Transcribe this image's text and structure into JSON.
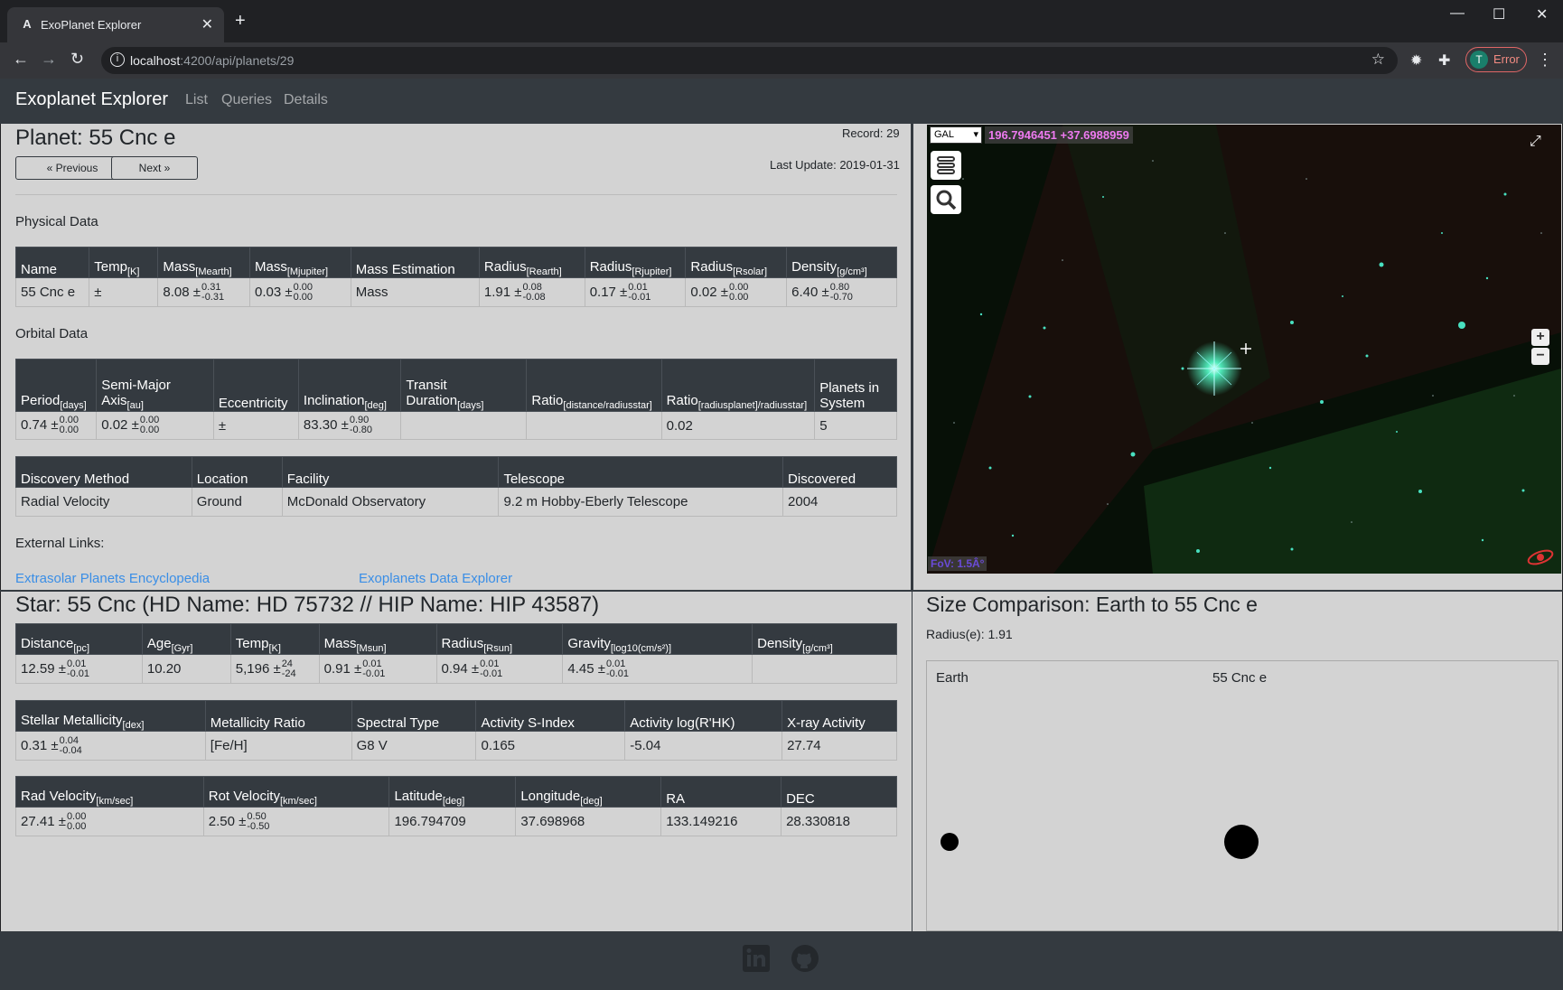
{
  "browser": {
    "tab_title": "ExoPlanet Explorer",
    "tab_close": "✕",
    "new_tab": "+",
    "url_host": "localhost",
    "url_path": ":4200/api/planets/29",
    "profile_initial": "T",
    "profile_status": "Error"
  },
  "app": {
    "brand": "Exoplanet Explorer",
    "nav": [
      "List",
      "Queries",
      "Details"
    ]
  },
  "planet": {
    "title": "Planet: 55 Cnc e",
    "record": "Record: 29",
    "last_update": "Last Update: 2019-01-31",
    "prev_label": "« Previous",
    "next_label": "Next »",
    "physical_label": "Physical Data",
    "orbital_label": "Orbital Data",
    "external_label": "External Links:",
    "links": [
      "Extrasolar Planets Encyclopedia",
      "Exoplanets Data Explorer"
    ],
    "physical": {
      "headers": [
        {
          "t": "Name",
          "s": ""
        },
        {
          "t": "Temp",
          "s": "[K]"
        },
        {
          "t": "Mass",
          "s": "[Mearth]"
        },
        {
          "t": "Mass",
          "s": "[Mjupiter]"
        },
        {
          "t": "Mass Estimation",
          "s": ""
        },
        {
          "t": "Radius",
          "s": "[Rearth]"
        },
        {
          "t": "Radius",
          "s": "[Rjupiter]"
        },
        {
          "t": "Radius",
          "s": "[Rsolar]"
        },
        {
          "t": "Density",
          "s": "[g/cm³]"
        }
      ],
      "row": [
        {
          "v": "55 Cnc e"
        },
        {
          "v": "±"
        },
        {
          "v": "8.08 ±",
          "up": "0.31",
          "dn": "-0.31"
        },
        {
          "v": "0.03 ±",
          "up": "0.00",
          "dn": "0.00"
        },
        {
          "v": "Mass"
        },
        {
          "v": "1.91 ±",
          "up": "0.08",
          "dn": "-0.08"
        },
        {
          "v": "0.17 ±",
          "up": "0.01",
          "dn": "-0.01"
        },
        {
          "v": "0.02 ±",
          "up": "0.00",
          "dn": "0.00"
        },
        {
          "v": "6.40 ±",
          "up": "0.80",
          "dn": "-0.70"
        }
      ]
    },
    "orbital": {
      "headers": [
        {
          "t": "Period",
          "s": "[days]"
        },
        {
          "t": "Semi-Major Axis",
          "s": "[au]"
        },
        {
          "t": "Eccentricity",
          "s": ""
        },
        {
          "t": "Inclination",
          "s": "[deg]"
        },
        {
          "t": "Transit Duration",
          "s": "[days]"
        },
        {
          "t": "Ratio",
          "s": "[distance/radiusstar]"
        },
        {
          "t": "Ratio",
          "s": "[radiusplanet]/radiusstar]"
        },
        {
          "t": "Planets in System",
          "s": ""
        }
      ],
      "row": [
        {
          "v": "0.74 ±",
          "up": "0.00",
          "dn": "0.00"
        },
        {
          "v": "0.02 ±",
          "up": "0.00",
          "dn": "0.00"
        },
        {
          "v": "±"
        },
        {
          "v": "83.30 ±",
          "up": "0.90",
          "dn": "-0.80"
        },
        {
          "v": ""
        },
        {
          "v": ""
        },
        {
          "v": "0.02"
        },
        {
          "v": "5"
        }
      ]
    },
    "discovery": {
      "headers": [
        "Discovery Method",
        "Location",
        "Facility",
        "Telescope",
        "Discovered"
      ],
      "row": [
        "Radial Velocity",
        "Ground",
        "McDonald Observatory",
        "9.2 m Hobby-Eberly Telescope",
        "2004"
      ]
    }
  },
  "sky": {
    "frame": "GAL",
    "coords": "196.7946451 +37.6988959",
    "fov": "FoV: 1.5Â°",
    "zoom_in": "+",
    "zoom_out": "−"
  },
  "star": {
    "title": "Star: 55 Cnc (HD Name: HD 75732 // HIP Name: HIP 43587)",
    "t1": {
      "headers": [
        {
          "t": "Distance",
          "s": "[pc]"
        },
        {
          "t": "Age",
          "s": "[Gyr]"
        },
        {
          "t": "Temp",
          "s": "[K]"
        },
        {
          "t": "Mass",
          "s": "[Msun]"
        },
        {
          "t": "Radius",
          "s": "[Rsun]"
        },
        {
          "t": "Gravity",
          "s": "[log10(cm/s²)]"
        },
        {
          "t": "Density",
          "s": "[g/cm³]"
        }
      ],
      "row": [
        {
          "v": "12.59 ±",
          "up": "0.01",
          "dn": "-0.01"
        },
        {
          "v": "10.20"
        },
        {
          "v": "5,196 ±",
          "up": "24",
          "dn": "-24"
        },
        {
          "v": "0.91 ±",
          "up": "0.01",
          "dn": "-0.01"
        },
        {
          "v": "0.94 ±",
          "up": "0.01",
          "dn": "-0.01"
        },
        {
          "v": "4.45 ±",
          "up": "0.01",
          "dn": "-0.01"
        },
        {
          "v": ""
        }
      ]
    },
    "t2": {
      "headers": [
        {
          "t": "Stellar Metallicity",
          "s": "[dex]"
        },
        {
          "t": "Metallicity Ratio",
          "s": ""
        },
        {
          "t": "Spectral Type",
          "s": ""
        },
        {
          "t": "Activity S-Index",
          "s": ""
        },
        {
          "t": "Activity log(R'HK)",
          "s": ""
        },
        {
          "t": "X-ray Activity",
          "s": ""
        }
      ],
      "row": [
        {
          "v": "0.31 ±",
          "up": "0.04",
          "dn": "-0.04"
        },
        {
          "v": "[Fe/H]"
        },
        {
          "v": "G8 V"
        },
        {
          "v": "0.165"
        },
        {
          "v": "-5.04"
        },
        {
          "v": "27.74"
        }
      ]
    },
    "t3": {
      "headers": [
        {
          "t": "Rad Velocity",
          "s": "[km/sec]"
        },
        {
          "t": "Rot Velocity",
          "s": "[km/sec]"
        },
        {
          "t": "Latitude",
          "s": "[deg]"
        },
        {
          "t": "Longitude",
          "s": "[deg]"
        },
        {
          "t": "RA",
          "s": ""
        },
        {
          "t": "DEC",
          "s": ""
        }
      ],
      "row": [
        {
          "v": "27.41 ±",
          "up": "0.00",
          "dn": "0.00"
        },
        {
          "v": "2.50 ±",
          "up": "0.50",
          "dn": "-0.50"
        },
        {
          "v": "196.794709"
        },
        {
          "v": "37.698968"
        },
        {
          "v": "133.149216"
        },
        {
          "v": "28.330818"
        }
      ]
    }
  },
  "size": {
    "title": "Size Comparison: Earth to 55 Cnc e",
    "radius": "Radius(e): 1.91",
    "earth_label": "Earth",
    "planet_label": "55 Cnc e",
    "earth_radius": 1,
    "planet_radius": 1.91
  },
  "icons": {
    "footer": [
      "linkedin-icon",
      "github-icon"
    ]
  }
}
